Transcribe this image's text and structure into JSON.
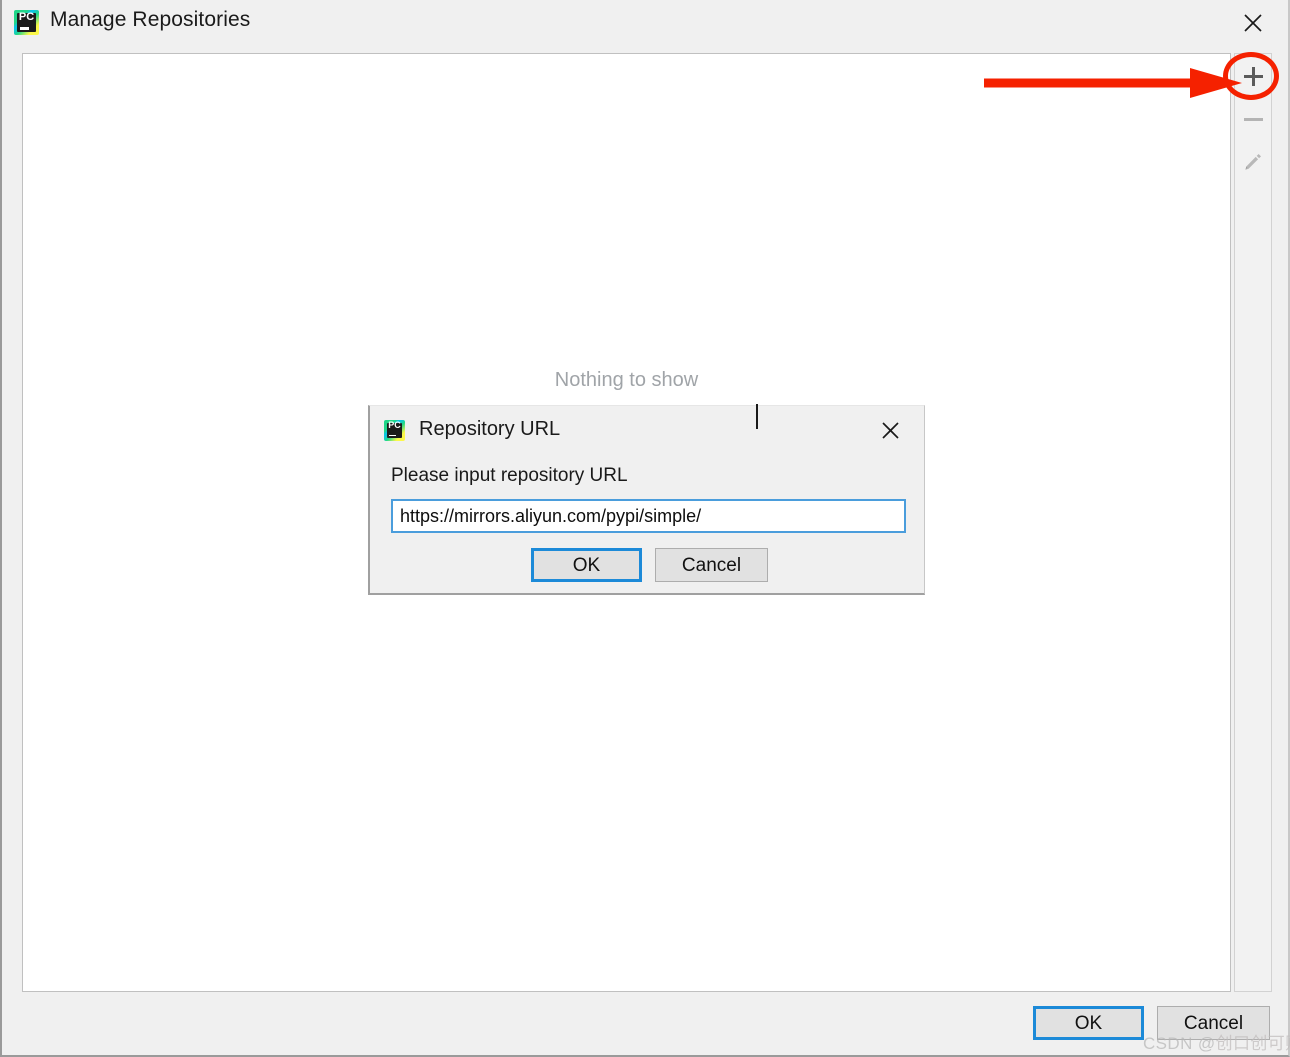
{
  "main_dialog": {
    "title": "Manage Repositories",
    "app_icon": "pycharm-icon",
    "close_icon": "close-icon",
    "empty_state": "Nothing to show",
    "toolbar": [
      {
        "name": "add",
        "icon": "plus-icon",
        "enabled": true
      },
      {
        "name": "remove",
        "icon": "minus-icon",
        "enabled": false
      },
      {
        "name": "edit",
        "icon": "pencil-icon",
        "enabled": true
      }
    ],
    "buttons": {
      "ok": "OK",
      "cancel": "Cancel"
    }
  },
  "repo_url_dialog": {
    "title": "Repository URL",
    "app_icon": "pycharm-icon",
    "close_icon": "close-icon",
    "prompt": "Please input repository URL",
    "input": {
      "value": "https://mirrors.aliyun.com/pypi/simple/",
      "placeholder": "",
      "focused": true
    },
    "buttons": {
      "ok": "OK",
      "cancel": "Cancel"
    }
  },
  "annotation": {
    "highlight_color": "#f52100",
    "target": "add-repository-button",
    "arrow_icon": "right-arrow-annotation",
    "circle_icon": "ellipse-highlight-annotation"
  },
  "watermark": {
    "prefix": "CSDN @",
    "text": "创口创可贴贴"
  },
  "colors": {
    "dialog_background": "#f0f0f0",
    "panel_background": "#ffffff",
    "focus_blue": "#1c8ad8",
    "input_border_blue": "#4a9ddc",
    "empty_text": "#a0a4a8",
    "glyph_gray": "#5b5b5b",
    "disabled_gray": "#b4b4b4"
  }
}
